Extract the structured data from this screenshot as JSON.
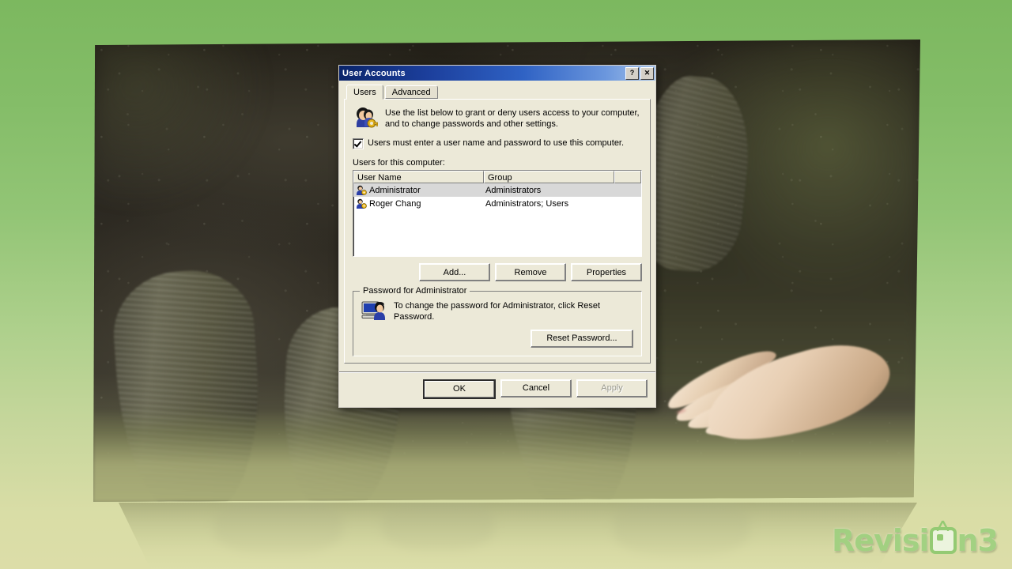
{
  "dialog": {
    "title": "User Accounts",
    "titlebar_buttons": [
      {
        "name": "help-button",
        "label": "?"
      },
      {
        "name": "close-button",
        "label": "✕"
      }
    ],
    "tabs": [
      {
        "label": "Users",
        "active": true
      },
      {
        "label": "Advanced",
        "active": false
      }
    ],
    "intro_text": "Use the list below to grant or deny users access to your computer, and to change passwords and other settings.",
    "intro_icon": "users-key-icon",
    "require_logon_checkbox": {
      "label": "Users must enter a user name and password to use this computer.",
      "checked": true
    },
    "list_label": "Users for this computer:",
    "list": {
      "columns": [
        "User Name",
        "Group",
        ""
      ],
      "rows": [
        {
          "user_name": "Administrator",
          "group": "Administrators",
          "selected": true,
          "icon": "user-account-icon"
        },
        {
          "user_name": "Roger Chang",
          "group": "Administrators; Users",
          "selected": false,
          "icon": "user-account-icon"
        }
      ]
    },
    "list_buttons": [
      {
        "name": "add-button",
        "label": "Add..."
      },
      {
        "name": "remove-button",
        "label": "Remove"
      },
      {
        "name": "properties-button",
        "label": "Properties"
      }
    ],
    "password_group": {
      "title": "Password for Administrator",
      "icon": "computer-user-icon",
      "text": "To change the password for Administrator, click Reset Password.",
      "button": {
        "name": "reset-password-button",
        "label": "Reset Password..."
      }
    },
    "footer_buttons": [
      {
        "name": "ok-button",
        "label": "OK",
        "default": true,
        "disabled": false
      },
      {
        "name": "cancel-button",
        "label": "Cancel",
        "default": false,
        "disabled": false
      },
      {
        "name": "apply-button",
        "label": "Apply",
        "default": false,
        "disabled": true
      }
    ]
  },
  "watermark": {
    "text_before": "Revisi",
    "text_after": "n3",
    "icon": "tv-antenna-icon",
    "full_text": "Revision3"
  },
  "colors": {
    "titlebar_start": "#0a246a",
    "titlebar_end": "#a6c3ea",
    "dialog_face": "#ece9d8",
    "selection": "#d8d8d8",
    "backdrop_top": "#7cb85f",
    "backdrop_bottom": "#dcdda8",
    "watermark_green": "#9ed07f"
  }
}
